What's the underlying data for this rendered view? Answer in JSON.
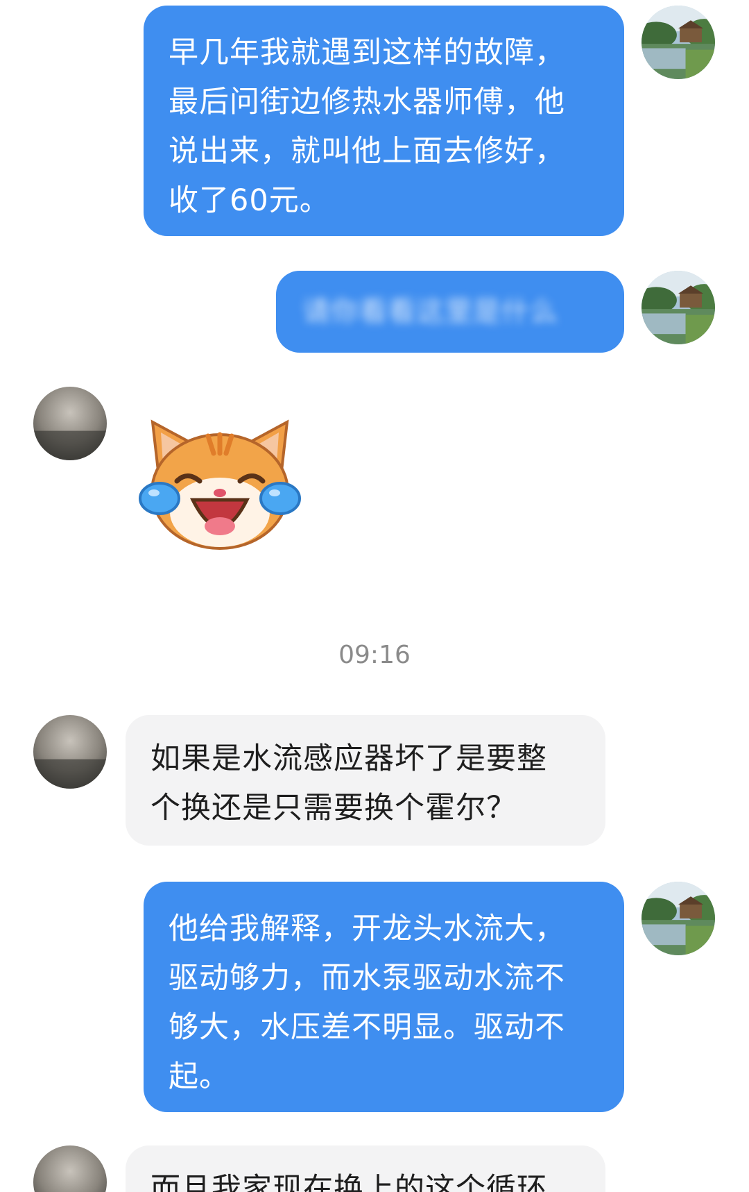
{
  "messages": [
    {
      "side": "me",
      "text": "早几年我就遇到这样的故障，\n最后问街边修热水器师傅，他\n说出来，就叫他上面去修好，\n收了60元。"
    },
    {
      "side": "me",
      "blurred": true,
      "text": "请你看看这里是什么"
    },
    {
      "side": "peer",
      "sticker": "laughing-cat-sticker"
    },
    {
      "side": "peer",
      "text": "如果是水流感应器坏了是要整\n个换还是只需要换个霍尔？"
    },
    {
      "side": "me",
      "text": "他给我解释，开龙头水流大，\n驱动够力，而水泵驱动水流不\n够大，水压差不明显。驱动不\n起。"
    },
    {
      "side": "peer",
      "text": "而且我家现在换上的这个循环"
    }
  ],
  "timestamp": "09:16",
  "colors": {
    "me_bubble": "#3f8ef0",
    "peer_bubble": "#f3f3f4",
    "timestamp": "#8a8a8a"
  },
  "icons": {
    "me_avatar": "lake-house-avatar",
    "peer_avatar": "cloudy-sky-avatar"
  }
}
